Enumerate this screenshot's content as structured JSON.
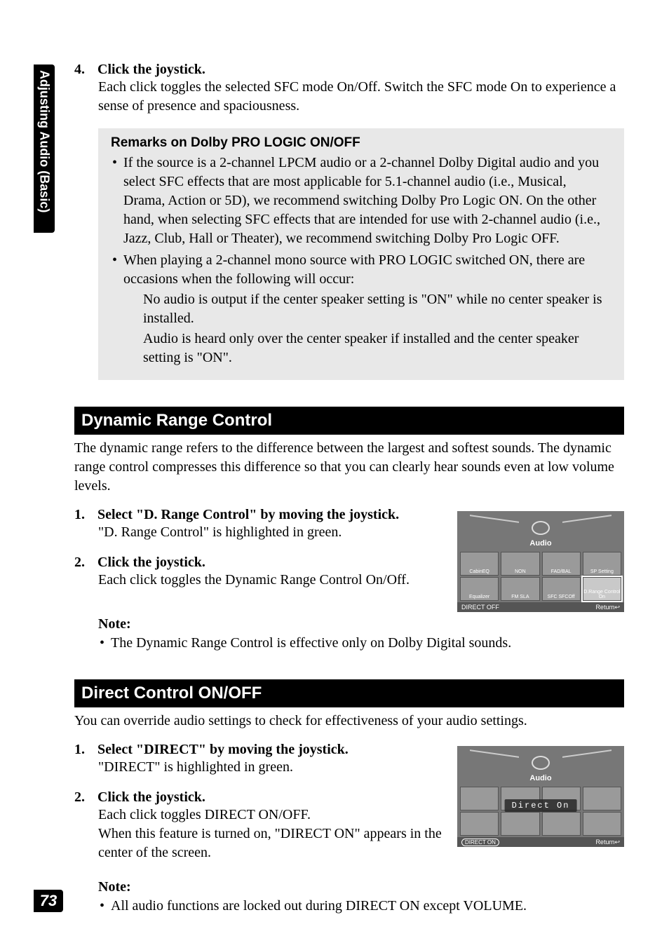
{
  "sideTab": "Adjusting Audio (Basic)",
  "pageNumber": "73",
  "step4": {
    "num": "4.",
    "title": "Click the joystick.",
    "body": "Each click toggles the selected SFC mode On/Off. Switch the SFC mode On to experience a sense of presence and spaciousness."
  },
  "remarks": {
    "title": "Remarks on Dolby PRO LOGIC ON/OFF",
    "b1": "If the source is a 2-channel LPCM audio or a 2-channel Dolby Digital audio and you select SFC effects that are most applicable for 5.1-channel audio (i.e., Musical, Drama, Action or 5D), we recommend switching Dolby Pro Logic ON. On the other hand, when selecting SFC effects that are intended for use with 2-channel audio (i.e., Jazz, Club, Hall or Theater), we recommend switching Dolby Pro Logic OFF.",
    "b2": "When playing a 2-channel mono source with PRO LOGIC switched ON, there are occasions when the following will occur:",
    "sub1": "No audio is output if the center speaker setting is \"ON\" while no center speaker is installed.",
    "sub2": "Audio is heard only over the center speaker if installed and the center speaker setting is \"ON\"."
  },
  "drc": {
    "heading": "Dynamic Range Control",
    "intro": "The dynamic range refers to the difference between the largest and softest sounds. The dynamic range control compresses this difference so that you can clearly hear sounds even at low volume levels.",
    "s1num": "1.",
    "s1title": "Select \"D. Range Control\" by moving the joystick.",
    "s1body": "\"D. Range Control\" is highlighted in green.",
    "s2num": "2.",
    "s2title": "Click the joystick.",
    "s2body": "Each click toggles the Dynamic Range Control On/Off.",
    "noteLabel": "Note:",
    "note1": "The Dynamic Range Control is effective only on Dolby Digital sounds."
  },
  "direct": {
    "heading": "Direct Control ON/OFF",
    "intro": "You can override audio settings to check for effectiveness of your audio settings.",
    "s1num": "1.",
    "s1title": "Select \"DIRECT\" by moving the joystick.",
    "s1body": "\"DIRECT\" is highlighted in green.",
    "s2num": "2.",
    "s2title": "Click the joystick.",
    "s2body1": "Each click toggles DIRECT ON/OFF.",
    "s2body2": "When this feature is turned on, \"DIRECT ON\" appears in the center of the screen.",
    "noteLabel": "Note:",
    "note1": "All audio functions are locked out during DIRECT ON except VOLUME."
  },
  "fig1": {
    "audio": "Audio",
    "cells": {
      "cabinEQ": "CabinEQ",
      "non": "NON",
      "fadbal": "FAD/BAL",
      "spsetting": "SP Setting",
      "equalizer": "Equalizer",
      "fmsla": "FM\nSLA",
      "sfcoff": "SFC\nSFCOff",
      "drange": "D.Range\nControl\nOn"
    },
    "bottomLeft": "DIRECT OFF",
    "bottomRight": "Return↩"
  },
  "fig2": {
    "audio": "Audio",
    "overlay": "Direct On",
    "bottomLeft": "DIRECT ON",
    "bottomRight": "Return↩"
  }
}
